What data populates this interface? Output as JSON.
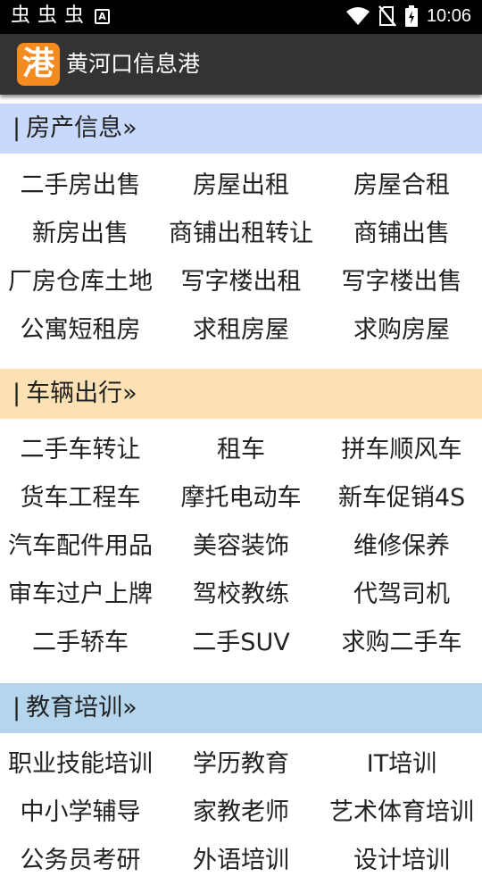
{
  "status_bar": {
    "time": "10:06",
    "left_icons": [
      "bug-icon",
      "bug-icon",
      "bug-icon",
      "a-notification-icon"
    ],
    "right_icons": [
      "wifi-icon",
      "no-sim-icon",
      "battery-charging-icon"
    ]
  },
  "app_bar": {
    "logo_char": "港",
    "title": "黄河口信息港",
    "logo_color": "#f58a1f",
    "background": "#333333"
  },
  "sections": [
    {
      "title": "房产信息»",
      "color": "#c8d9fb",
      "items": [
        "二手房出售",
        "房屋出租",
        "房屋合租",
        "新房出售",
        "商铺出租转让",
        "商铺出售",
        "厂房仓库土地",
        "写字楼出租",
        "写字楼出售",
        "公寓短租房",
        "求租房屋",
        "求购房屋"
      ]
    },
    {
      "title": "车辆出行»",
      "color": "#fce1b5",
      "items": [
        "二手车转让",
        "租车",
        "拼车顺风车",
        "货车工程车",
        "摩托电动车",
        "新车促销4S",
        "汽车配件用品",
        "美容装饰",
        "维修保养",
        "审车过户上牌",
        "驾校教练",
        "代驾司机",
        "二手轿车",
        "二手SUV",
        "求购二手车"
      ]
    },
    {
      "title": "教育培训»",
      "color": "#b4d5ec",
      "items": [
        "职业技能培训",
        "学历教育",
        "IT培训",
        "中小学辅导",
        "家教老师",
        "艺术体育培训",
        "公务员考研",
        "外语培训",
        "设计培训"
      ]
    }
  ]
}
